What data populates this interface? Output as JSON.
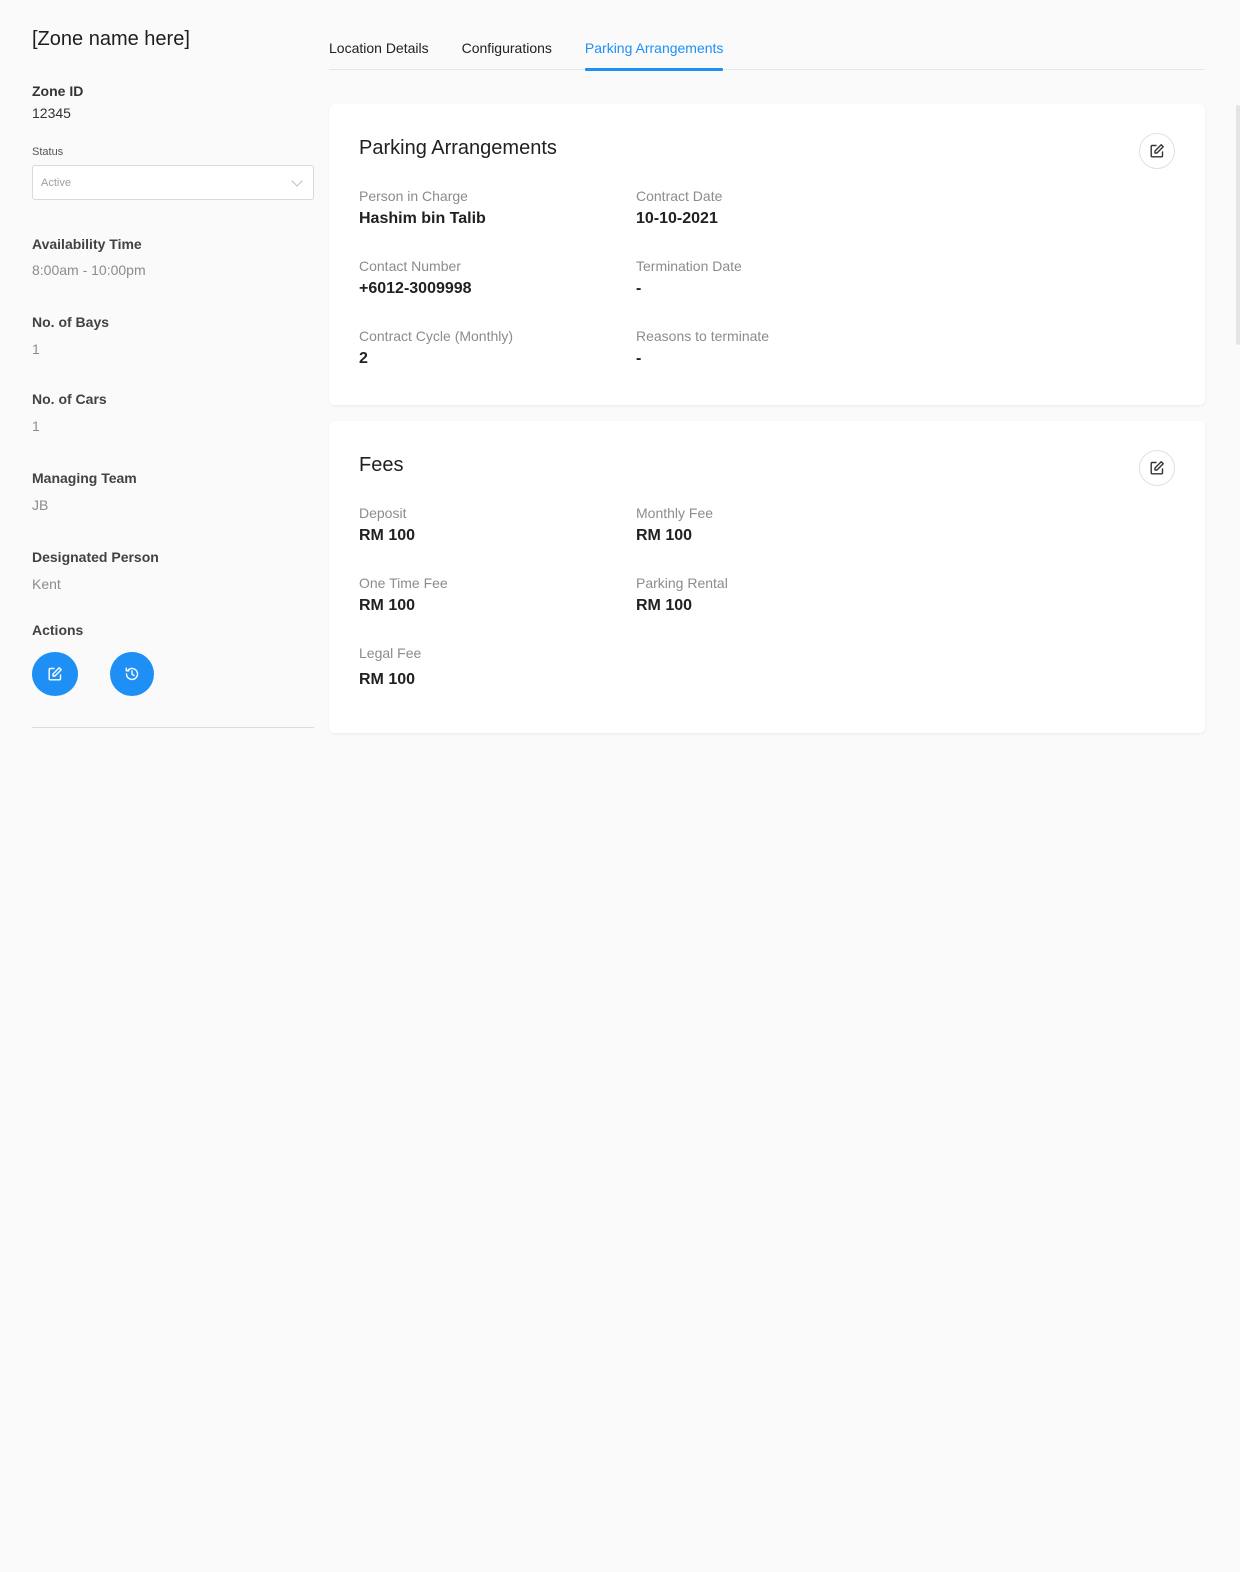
{
  "sidebar": {
    "title": "[Zone name here]",
    "zone_id_label": "Zone ID",
    "zone_id_value": "12345",
    "status_label": "Status",
    "status_value": "Active",
    "availability_label": "Availability Time",
    "availability_value": "8:00am - 10:00pm",
    "bays_label": "No. of Bays",
    "bays_value": "1",
    "cars_label": "No. of Cars",
    "cars_value": "1",
    "team_label": "Managing Team",
    "team_value": "JB",
    "designated_label": "Designated Person",
    "designated_value": "Kent",
    "actions_label": "Actions",
    "action_edit_icon": "edit-icon",
    "action_history_icon": "history-icon"
  },
  "tabs": [
    {
      "label": "Location Details",
      "active": false
    },
    {
      "label": "Configurations",
      "active": false
    },
    {
      "label": "Parking Arrangements",
      "active": true
    }
  ],
  "accent_color": "#1e90f5",
  "parking": {
    "title": "Parking Arrangements",
    "person_in_charge_label": "Person in Charge",
    "person_in_charge_value": "Hashim bin Talib",
    "contract_date_label": "Contract Date",
    "contract_date_value": "10-10-2021",
    "contact_number_label": "Contact Number",
    "contact_number_value": "+6012-3009998",
    "termination_date_label": "Termination Date",
    "termination_date_value": "-",
    "contract_cycle_label": "Contract Cycle (Monthly)",
    "contract_cycle_value": "2",
    "reasons_label": "Reasons to terminate",
    "reasons_value": "-"
  },
  "fees": {
    "title": "Fees",
    "deposit_label": "Deposit",
    "deposit_value": "RM 100",
    "monthly_fee_label": "Monthly Fee",
    "monthly_fee_value": "RM 100",
    "one_time_fee_label": "One Time Fee",
    "one_time_fee_value": "RM 100",
    "parking_rental_label": "Parking Rental",
    "parking_rental_value": "RM 100",
    "legal_fee_label": "Legal Fee",
    "legal_fee_value": "RM 100"
  }
}
